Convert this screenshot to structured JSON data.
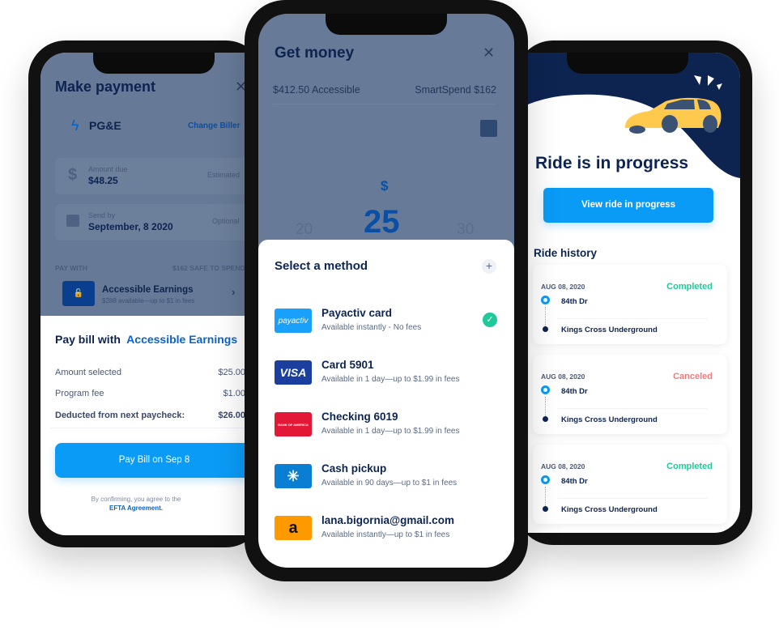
{
  "left": {
    "title": "Make payment",
    "close": "✕",
    "biller": "PG&E",
    "change_biller": "Change Biller",
    "amount_label": "Amount due",
    "amount": "$48.25",
    "amount_tag": "Estimated",
    "send_label": "Send by",
    "send_date": "September, 8 2020",
    "send_tag": "Optional",
    "pay_with": "PAY WITH",
    "safe": "$162 SAFE TO SPEND",
    "source_title": "Accessible Earnings",
    "source_sub": "$288 available—up to $1 in fees",
    "sheet": {
      "title_a": "Pay bill with",
      "title_b": "Accessible Earnings",
      "rows": [
        {
          "label": "Amount selected",
          "value": "$25.00"
        },
        {
          "label": "Program fee",
          "value": "$1.00"
        },
        {
          "label": "Deducted from next paycheck:",
          "value": "$26.00"
        }
      ],
      "button": "Pay Bill on Sep 8",
      "note": "By confirming, you agree to the",
      "link": "EFTA Agreement."
    }
  },
  "center": {
    "title": "Get money",
    "close": "✕",
    "accessible": "$412.50 Accessible",
    "smartspend": "SmartSpend $162",
    "currency": "$",
    "amount": "25",
    "prev": "20",
    "next": "30",
    "sheet_title": "Select a method",
    "add": "+",
    "methods": [
      {
        "icon": "payactiv",
        "icon_text": "payactiv",
        "title": "Payactiv card",
        "sub": "Available instantly - No fees",
        "selected": true,
        "color": "#18a0fb"
      },
      {
        "icon": "visa",
        "icon_text": "VISA",
        "title": "Card 5901",
        "sub": "Available in 1 day—up to $1.99 in fees",
        "color": "#1a3f9e"
      },
      {
        "icon": "bank-of-america",
        "icon_text": "BANK OF AMERICA",
        "title": "Checking 6019",
        "sub": "Available in 1 day—up to $1.99 in fees",
        "color": "#e31837"
      },
      {
        "icon": "walmart",
        "icon_text": "✳",
        "title": "Cash pickup",
        "sub": "Available in 90 days—up to $1 in fees",
        "color": "#0a7ed3"
      },
      {
        "icon": "amazon",
        "icon_text": "a",
        "title": "lana.bigornia@gmail.com",
        "sub": "Available instantly—up to $1 in fees",
        "color": "#ff9900"
      }
    ]
  },
  "right": {
    "title": "Ride is in progress",
    "button": "View ride in progress",
    "history": "Ride history",
    "rides": [
      {
        "date": "AUG 08, 2020",
        "status": "Completed",
        "from": "84th Dr",
        "to": "Kings Cross Underground",
        "status_color": "#1ec99a"
      },
      {
        "date": "AUG 08, 2020",
        "status": "Canceled",
        "from": "84th Dr",
        "to": "Kings Cross Underground",
        "status_color": "#f07a7a"
      },
      {
        "date": "AUG 08, 2020",
        "status": "Completed",
        "from": "84th Dr",
        "to": "Kings Cross Underground",
        "status_color": "#1ec99a"
      }
    ]
  },
  "colors": {
    "navy": "#0d2451",
    "accent": "#0a9bf7",
    "link": "#0a63c9",
    "dim": "#677b98"
  }
}
